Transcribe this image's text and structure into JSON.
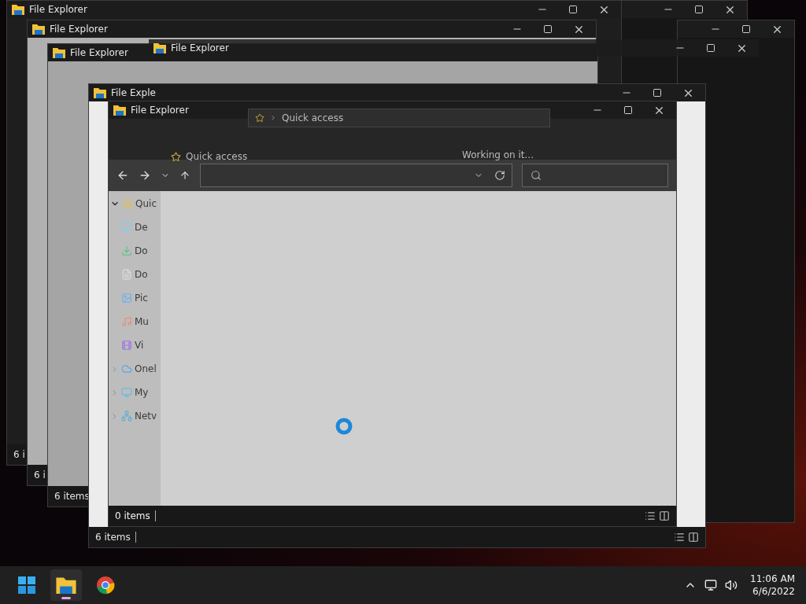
{
  "windows": [
    {
      "title": "File Explorer",
      "status": "6 i"
    },
    {
      "title": "File Explorer",
      "status": "6 i"
    },
    {
      "title": "File Explorer",
      "status": "6 items"
    },
    {
      "title": "File Exple",
      "status": "6 items"
    },
    {
      "title": "File Explorer",
      "status": "0 items",
      "sidebar": [
        {
          "label": "Quic",
          "kind": "star",
          "expanded": true,
          "children": [
            {
              "label": "De",
              "kind": "desktop"
            },
            {
              "label": "Do",
              "kind": "download"
            },
            {
              "label": "Do",
              "kind": "document"
            },
            {
              "label": "Pic",
              "kind": "picture"
            },
            {
              "label": "Mu",
              "kind": "music"
            },
            {
              "label": "Vi",
              "kind": "video"
            }
          ]
        },
        {
          "label": "Onel",
          "kind": "cloud",
          "expanded": false
        },
        {
          "label": "My",
          "kind": "pc",
          "expanded": false
        },
        {
          "label": "Netv",
          "kind": "network",
          "expanded": false
        }
      ]
    }
  ],
  "overlay_window": {
    "title": "File Explorer",
    "breadcrumb": "Quick access",
    "heading": "Quick access",
    "message": "Working on it..."
  },
  "taskbar": {
    "apps": [
      {
        "kind": "start",
        "running": false
      },
      {
        "kind": "explorer",
        "running": true
      },
      {
        "kind": "chrome",
        "running": false
      }
    ],
    "time": "11:06 AM",
    "date": "6/6/2022"
  }
}
